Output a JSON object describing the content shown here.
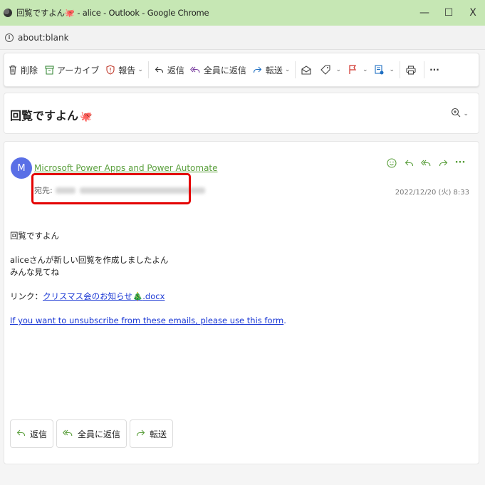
{
  "window": {
    "title": "回覧ですよん🐙 - alice - Outlook - Google Chrome",
    "controls": {
      "minimize": "—",
      "maximize": "☐",
      "close": "X"
    }
  },
  "address_bar": {
    "url": "about:blank"
  },
  "toolbar": {
    "delete_label": "削除",
    "archive_label": "アーカイブ",
    "report_label": "報告",
    "reply_label": "返信",
    "reply_all_label": "全員に返信",
    "forward_label": "転送",
    "more_label": "···"
  },
  "subject": {
    "text": "回覧ですよん",
    "emoji": "🐙"
  },
  "message": {
    "avatar_letter": "M",
    "sender": "Microsoft Power Apps and Power Automate",
    "to_label": "宛先:",
    "timestamp": "2022/12/20 (火) 8:33",
    "body": {
      "line1": "回覧ですよん",
      "line2": "aliceさんが新しい回覧を作成しましたよん",
      "line3": "みんな見てね",
      "link_prefix": "リンク：",
      "link_text": "クリスマス会のお知らせ",
      "link_emoji": "🎄",
      "link_ext": ".docx",
      "unsubscribe": "If you want to unsubscribe from these emails, please use this form",
      "unsubscribe_period": "."
    },
    "more_label": "···"
  },
  "actions": {
    "reply": "返信",
    "reply_all": "全員に返信",
    "forward": "転送"
  },
  "colors": {
    "titlebar": "#c6e7b4",
    "accent_green": "#5a9f3c",
    "avatar": "#5a6fe6",
    "highlight": "#e40000",
    "link": "#1a37d4"
  }
}
